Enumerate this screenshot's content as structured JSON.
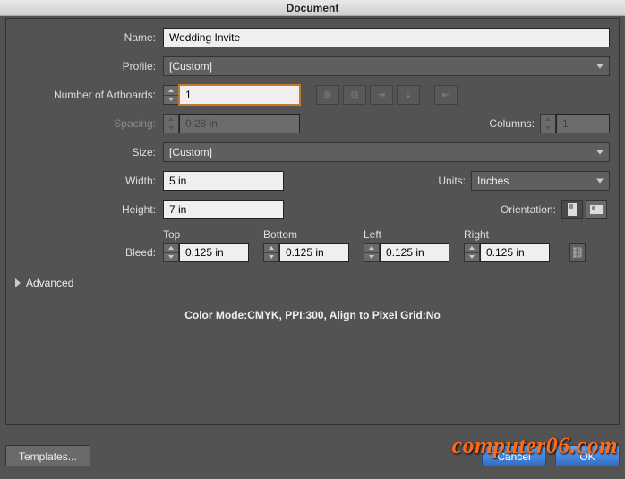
{
  "title": "Document",
  "labels": {
    "name": "Name:",
    "profile": "Profile:",
    "artboards": "Number of Artboards:",
    "spacing": "Spacing:",
    "columns": "Columns:",
    "size": "Size:",
    "width": "Width:",
    "height": "Height:",
    "units": "Units:",
    "orientation": "Orientation:",
    "bleed": "Bleed:",
    "top": "Top",
    "bottom": "Bottom",
    "left": "Left",
    "right": "Right",
    "advanced": "Advanced",
    "templates": "Templates...",
    "cancel": "Cancel",
    "ok": "OK"
  },
  "values": {
    "name": "Wedding Invite",
    "profile": "[Custom]",
    "artboards": "1",
    "spacing": "0.28 in",
    "columns": "1",
    "size": "[Custom]",
    "width": "5 in",
    "height": "7 in",
    "units": "Inches",
    "bleed_top": "0.125 in",
    "bleed_bottom": "0.125 in",
    "bleed_left": "0.125 in",
    "bleed_right": "0.125 in"
  },
  "summary": "Color Mode:CMYK, PPI:300, Align to Pixel Grid:No",
  "watermark": "computer06.com"
}
